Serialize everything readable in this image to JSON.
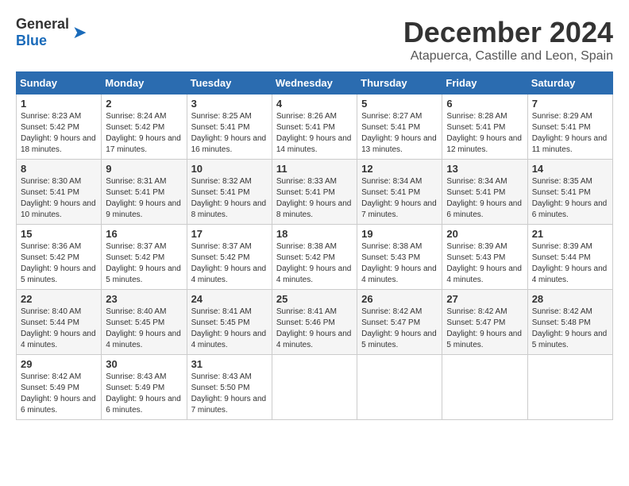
{
  "logo": {
    "general": "General",
    "blue": "Blue"
  },
  "title": "December 2024",
  "location": "Atapuerca, Castille and Leon, Spain",
  "days_of_week": [
    "Sunday",
    "Monday",
    "Tuesday",
    "Wednesday",
    "Thursday",
    "Friday",
    "Saturday"
  ],
  "weeks": [
    [
      {
        "day": 1,
        "sunrise": "8:23 AM",
        "sunset": "5:42 PM",
        "daylight": "9 hours and 18 minutes."
      },
      {
        "day": 2,
        "sunrise": "8:24 AM",
        "sunset": "5:42 PM",
        "daylight": "9 hours and 17 minutes."
      },
      {
        "day": 3,
        "sunrise": "8:25 AM",
        "sunset": "5:41 PM",
        "daylight": "9 hours and 16 minutes."
      },
      {
        "day": 4,
        "sunrise": "8:26 AM",
        "sunset": "5:41 PM",
        "daylight": "9 hours and 14 minutes."
      },
      {
        "day": 5,
        "sunrise": "8:27 AM",
        "sunset": "5:41 PM",
        "daylight": "9 hours and 13 minutes."
      },
      {
        "day": 6,
        "sunrise": "8:28 AM",
        "sunset": "5:41 PM",
        "daylight": "9 hours and 12 minutes."
      },
      {
        "day": 7,
        "sunrise": "8:29 AM",
        "sunset": "5:41 PM",
        "daylight": "9 hours and 11 minutes."
      }
    ],
    [
      {
        "day": 8,
        "sunrise": "8:30 AM",
        "sunset": "5:41 PM",
        "daylight": "9 hours and 10 minutes."
      },
      {
        "day": 9,
        "sunrise": "8:31 AM",
        "sunset": "5:41 PM",
        "daylight": "9 hours and 9 minutes."
      },
      {
        "day": 10,
        "sunrise": "8:32 AM",
        "sunset": "5:41 PM",
        "daylight": "9 hours and 8 minutes."
      },
      {
        "day": 11,
        "sunrise": "8:33 AM",
        "sunset": "5:41 PM",
        "daylight": "9 hours and 8 minutes."
      },
      {
        "day": 12,
        "sunrise": "8:34 AM",
        "sunset": "5:41 PM",
        "daylight": "9 hours and 7 minutes."
      },
      {
        "day": 13,
        "sunrise": "8:34 AM",
        "sunset": "5:41 PM",
        "daylight": "9 hours and 6 minutes."
      },
      {
        "day": 14,
        "sunrise": "8:35 AM",
        "sunset": "5:41 PM",
        "daylight": "9 hours and 6 minutes."
      }
    ],
    [
      {
        "day": 15,
        "sunrise": "8:36 AM",
        "sunset": "5:42 PM",
        "daylight": "9 hours and 5 minutes."
      },
      {
        "day": 16,
        "sunrise": "8:37 AM",
        "sunset": "5:42 PM",
        "daylight": "9 hours and 5 minutes."
      },
      {
        "day": 17,
        "sunrise": "8:37 AM",
        "sunset": "5:42 PM",
        "daylight": "9 hours and 4 minutes."
      },
      {
        "day": 18,
        "sunrise": "8:38 AM",
        "sunset": "5:42 PM",
        "daylight": "9 hours and 4 minutes."
      },
      {
        "day": 19,
        "sunrise": "8:38 AM",
        "sunset": "5:43 PM",
        "daylight": "9 hours and 4 minutes."
      },
      {
        "day": 20,
        "sunrise": "8:39 AM",
        "sunset": "5:43 PM",
        "daylight": "9 hours and 4 minutes."
      },
      {
        "day": 21,
        "sunrise": "8:39 AM",
        "sunset": "5:44 PM",
        "daylight": "9 hours and 4 minutes."
      }
    ],
    [
      {
        "day": 22,
        "sunrise": "8:40 AM",
        "sunset": "5:44 PM",
        "daylight": "9 hours and 4 minutes."
      },
      {
        "day": 23,
        "sunrise": "8:40 AM",
        "sunset": "5:45 PM",
        "daylight": "9 hours and 4 minutes."
      },
      {
        "day": 24,
        "sunrise": "8:41 AM",
        "sunset": "5:45 PM",
        "daylight": "9 hours and 4 minutes."
      },
      {
        "day": 25,
        "sunrise": "8:41 AM",
        "sunset": "5:46 PM",
        "daylight": "9 hours and 4 minutes."
      },
      {
        "day": 26,
        "sunrise": "8:42 AM",
        "sunset": "5:47 PM",
        "daylight": "9 hours and 5 minutes."
      },
      {
        "day": 27,
        "sunrise": "8:42 AM",
        "sunset": "5:47 PM",
        "daylight": "9 hours and 5 minutes."
      },
      {
        "day": 28,
        "sunrise": "8:42 AM",
        "sunset": "5:48 PM",
        "daylight": "9 hours and 5 minutes."
      }
    ],
    [
      {
        "day": 29,
        "sunrise": "8:42 AM",
        "sunset": "5:49 PM",
        "daylight": "9 hours and 6 minutes."
      },
      {
        "day": 30,
        "sunrise": "8:43 AM",
        "sunset": "5:49 PM",
        "daylight": "9 hours and 6 minutes."
      },
      {
        "day": 31,
        "sunrise": "8:43 AM",
        "sunset": "5:50 PM",
        "daylight": "9 hours and 7 minutes."
      },
      null,
      null,
      null,
      null
    ]
  ],
  "labels": {
    "sunrise": "Sunrise:",
    "sunset": "Sunset:",
    "daylight": "Daylight:"
  }
}
